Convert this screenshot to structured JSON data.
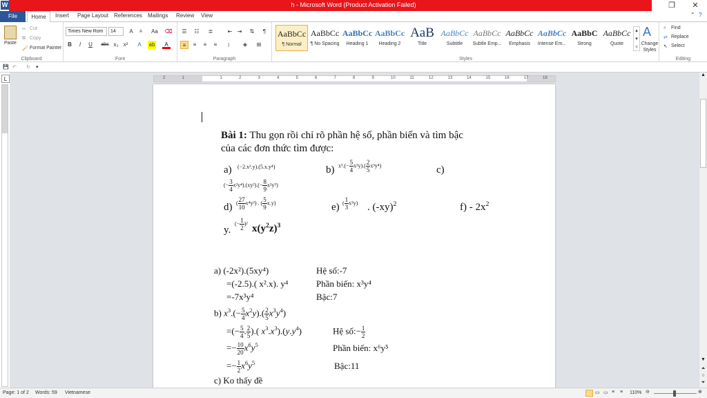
{
  "window": {
    "title": "h - Microsoft Word (Product Activation Failed)",
    "app_icon": "W",
    "restore": "❐",
    "close": "✕"
  },
  "tabs": [
    "File",
    "Home",
    "Insert",
    "Page Layout",
    "References",
    "Mailings",
    "Review",
    "View"
  ],
  "help": "?",
  "ribbon": {
    "clipboard": {
      "paste": "Paste",
      "cut": "Cut",
      "copy": "Copy",
      "format_painter": "Format Painter",
      "label": "Clipboard"
    },
    "font": {
      "name": "Times New Rom",
      "size": "14",
      "label": "Font",
      "bold": "B",
      "italic": "I",
      "underline": "U",
      "strike": "abc",
      "sub": "x₂",
      "sup": "x²",
      "grow": "A",
      "shrink": "A",
      "case": "Aa"
    },
    "paragraph": {
      "label": "Paragraph",
      "pilcrow": "¶"
    },
    "styles": {
      "label": "Styles",
      "items": [
        {
          "preview": "AaBbCc",
          "name": "¶ Normal"
        },
        {
          "preview": "AaBbCc",
          "name": "¶ No Spacing"
        },
        {
          "preview": "AaBbCc",
          "name": "Heading 1"
        },
        {
          "preview": "AaBbCc",
          "name": "Heading 2"
        },
        {
          "preview": "AaB",
          "name": "Title"
        },
        {
          "preview": "AaBbCc",
          "name": "Subtitle"
        },
        {
          "preview": "AaBbCc",
          "name": "Subtle Emp..."
        },
        {
          "preview": "AaBbCc",
          "name": "Emphasis"
        },
        {
          "preview": "AaBbCc",
          "name": "Intense Em..."
        },
        {
          "preview": "AaBbC",
          "name": "Strong"
        },
        {
          "preview": "AaBbCc",
          "name": "Quote"
        }
      ],
      "change": "Change Styles"
    },
    "editing": {
      "label": "Editing",
      "find": "Find",
      "replace": "Replace",
      "select": "Select"
    }
  },
  "ruler": {
    "ticks": [
      "2",
      "1",
      "1",
      "2",
      "3",
      "4",
      "5",
      "6",
      "7",
      "8",
      "9",
      "10",
      "11",
      "12",
      "13",
      "14",
      "15",
      "16",
      "17",
      "18"
    ]
  },
  "document": {
    "bai_title": "Bài 1:",
    "bai_text1": " Thu gọn rồi chỉ rõ phần hệ số, phần biến và tìm bậc",
    "bai_text2": "của các đơn thức tìm được:",
    "a_label": "a)",
    "b_label": "b)",
    "c_label": "c)",
    "d_label": "d)",
    "e_label": "e)",
    "e_tail": ". (-xy)",
    "f_label": "f) - 2x",
    "y_label": "y.",
    "y_tail": "x(y",
    "sol_a1": "a)  (-2x²).(5xy⁴)",
    "sol_a1_right": "Hệ số:-7",
    "sol_a2": "=(-2.5).( x².x). y⁴",
    "sol_a2_right": "Phần biến: x³y⁴",
    "sol_a3": "=-7x³y⁴",
    "sol_a3_right": "Bậc:7",
    "sol_b_label": "b)",
    "sol_b2_right": "Hệ số:−",
    "sol_b3_right": "Phần biến: x⁶y⁵",
    "sol_b4_right": "Bậc:11",
    "sol_c": "c)  Ko thấy đề"
  },
  "status": {
    "page": "Page: 1 of 2",
    "words": "Words: 59",
    "language": "Vietnamese",
    "zoom": "110%"
  }
}
